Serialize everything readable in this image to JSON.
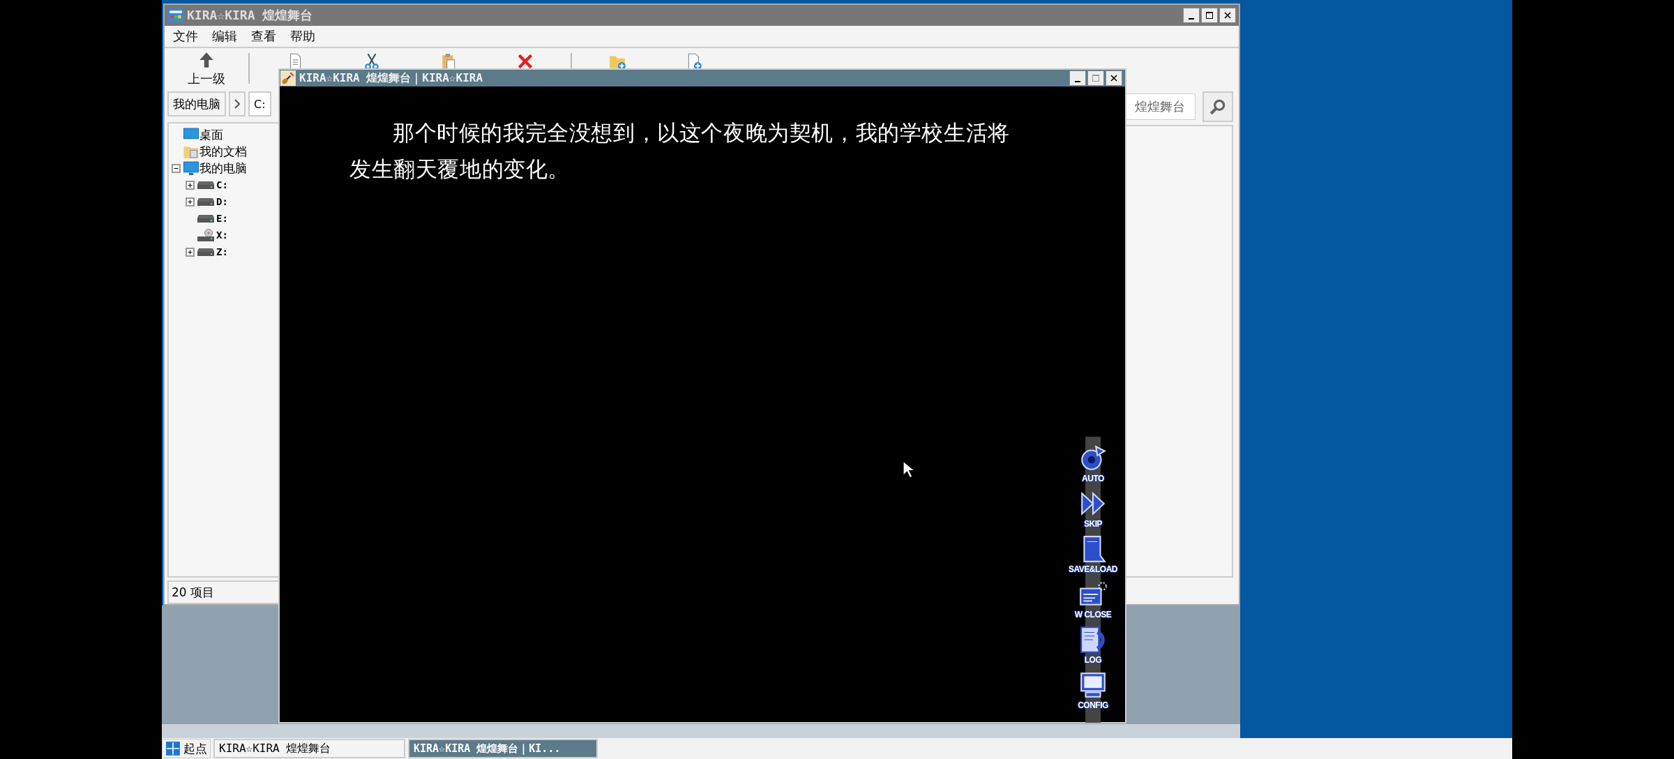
{
  "explorer": {
    "title": "KIRA☆KIRA 煌煌舞台",
    "menu": [
      "文件",
      "编辑",
      "查看",
      "帮助"
    ],
    "toolbar": [
      {
        "kind": "up",
        "label": "上一级"
      },
      {
        "kind": "separator"
      },
      {
        "kind": "copy"
      },
      {
        "kind": "cut"
      },
      {
        "kind": "paste"
      },
      {
        "kind": "delete"
      },
      {
        "kind": "separator"
      },
      {
        "kind": "new-folder"
      },
      {
        "kind": "new-file"
      }
    ],
    "address": {
      "crumb": "我的电脑",
      "path": "C:"
    },
    "search": {
      "value": "煌煌舞台"
    },
    "tree": [
      {
        "kind": "desktop",
        "label": "桌面"
      },
      {
        "kind": "documents",
        "label": "我的文档"
      },
      {
        "kind": "computer",
        "label": "我的电脑",
        "expanded": true,
        "children": [
          {
            "kind": "drive",
            "label": "C:",
            "expanded": false
          },
          {
            "kind": "drive",
            "label": "D:",
            "expanded": false
          },
          {
            "kind": "drive",
            "label": "E:"
          },
          {
            "kind": "disc",
            "label": "X:"
          },
          {
            "kind": "drive",
            "label": "Z:",
            "expanded": false
          }
        ]
      }
    ],
    "status": "20 项目"
  },
  "game": {
    "title": "KIRA☆KIRA 煌煌舞台｜KIRA☆KIRA",
    "text": "那个时候的我完全没想到，以这个夜晚为契机，我的学校生活将发生翻天覆地的变化。",
    "controls": [
      {
        "kind": "auto",
        "label": "AUTO"
      },
      {
        "kind": "skip",
        "label": "SKIP"
      },
      {
        "kind": "save",
        "label": "SAVE&LOAD"
      },
      {
        "kind": "close",
        "label": "W CLOSE"
      },
      {
        "kind": "log",
        "label": "LOG"
      },
      {
        "kind": "config",
        "label": "CONFIG"
      }
    ]
  },
  "taskbar": {
    "start": "起点",
    "tasks": [
      {
        "label": "KIRA☆KIRA 煌煌舞台",
        "selected": false
      },
      {
        "label": "KIRA☆KIRA 煌煌舞台｜KI...",
        "selected": true
      }
    ]
  }
}
